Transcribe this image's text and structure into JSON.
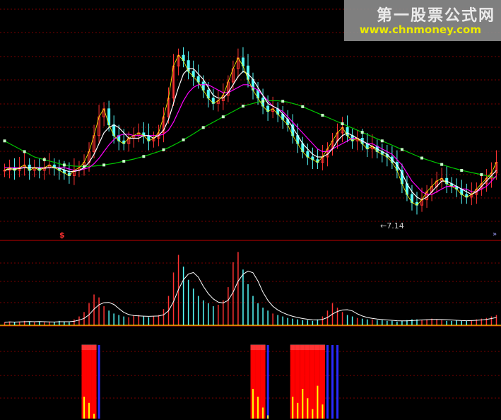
{
  "watermark": {
    "title": "第一股票公式网",
    "url": "www.chnmoney.com"
  },
  "annotations": {
    "low_label": "←7.14",
    "s_marker": "$",
    "right_marker": "»"
  },
  "colors": {
    "background": "#000000",
    "grid": "#7a0000",
    "divider": "#c00000",
    "up": "#ff3232",
    "down": "#54fcfc",
    "ma_white": "#ffffff",
    "ma_yellow": "#ffff00",
    "ma_magenta": "#ff00ff",
    "ma_green": "#00c800",
    "signal_red": "#ff0000",
    "signal_blue": "#2a2aff",
    "signal_yellow": "#ffff00"
  },
  "chart_data": [
    {
      "type": "candlestick",
      "panel": "price",
      "low_value": 7.14,
      "close": [
        8.5,
        8.6,
        8.5,
        8.6,
        8.7,
        8.5,
        8.6,
        8.5,
        8.6,
        8.7,
        8.6,
        8.5,
        8.4,
        8.3,
        8.5,
        8.6,
        8.8,
        9.2,
        9.8,
        10.5,
        10.8,
        10.2,
        9.8,
        9.6,
        9.5,
        9.7,
        9.8,
        9.9,
        9.8,
        9.6,
        9.7,
        9.9,
        10.5,
        11.2,
        12.4,
        12.8,
        12.6,
        12.2,
        12.0,
        11.8,
        11.5,
        11.2,
        11.0,
        11.1,
        11.3,
        11.8,
        12.3,
        12.7,
        12.4,
        11.9,
        11.5,
        11.2,
        10.9,
        10.7,
        10.8,
        10.6,
        10.4,
        10.2,
        9.8,
        9.5,
        9.2,
        9.0,
        8.9,
        8.8,
        9.0,
        9.3,
        9.6,
        9.9,
        10.1,
        9.8,
        9.6,
        9.7,
        9.5,
        9.3,
        9.4,
        9.2,
        9.1,
        9.0,
        8.8,
        8.5,
        8.0,
        7.6,
        7.3,
        7.2,
        7.4,
        7.7,
        7.9,
        8.1,
        8.2,
        8.0,
        7.9,
        7.8,
        7.6,
        7.5,
        7.6,
        7.8,
        8.0,
        8.2,
        8.4,
        8.8
      ],
      "ma_short": [
        8.5,
        8.55,
        8.55,
        8.57,
        8.6,
        8.6,
        8.6,
        8.58,
        8.58,
        8.6,
        8.6,
        8.58,
        8.52,
        8.45,
        8.46,
        8.5,
        8.6,
        8.8,
        9.1,
        9.5,
        9.9,
        10.1,
        10.2,
        10.1,
        9.9,
        9.7,
        9.7,
        9.7,
        9.8,
        9.8,
        9.7,
        9.8,
        10.0,
        10.4,
        11.0,
        11.6,
        12.1,
        12.3,
        12.3,
        12.1,
        11.9,
        11.6,
        11.3,
        11.2,
        11.2,
        11.4,
        11.7,
        12.0,
        12.2,
        12.1,
        11.9,
        11.6,
        11.3,
        11.0,
        10.9,
        10.8,
        10.6,
        10.4,
        10.1,
        9.8,
        9.5,
        9.3,
        9.1,
        9.0,
        9.0,
        9.1,
        9.3,
        9.6,
        9.8,
        9.9,
        9.8,
        9.7,
        9.6,
        9.5,
        9.4,
        9.3,
        9.2,
        9.1,
        8.9,
        8.7,
        8.4,
        8.0,
        7.7,
        7.5,
        7.4,
        7.5,
        7.7,
        7.9,
        8.1,
        8.1,
        8.0,
        7.9,
        7.8,
        7.7,
        7.6,
        7.7,
        7.9,
        8.1,
        8.3,
        8.5
      ],
      "ma_mid": [
        8.6,
        8.6,
        8.6,
        8.6,
        8.6,
        8.6,
        8.6,
        8.6,
        8.6,
        8.6,
        8.6,
        8.6,
        8.6,
        8.55,
        8.5,
        8.5,
        8.55,
        8.6,
        8.75,
        8.95,
        9.2,
        9.45,
        9.65,
        9.8,
        9.85,
        9.85,
        9.8,
        9.8,
        9.8,
        9.8,
        9.8,
        9.8,
        9.85,
        10.0,
        10.3,
        10.7,
        11.1,
        11.4,
        11.6,
        11.7,
        11.7,
        11.7,
        11.6,
        11.5,
        11.4,
        11.4,
        11.5,
        11.6,
        11.7,
        11.7,
        11.6,
        11.5,
        11.3,
        11.1,
        10.9,
        10.8,
        10.7,
        10.5,
        10.3,
        10.1,
        9.9,
        9.7,
        9.5,
        9.3,
        9.2,
        9.2,
        9.3,
        9.4,
        9.5,
        9.6,
        9.7,
        9.7,
        9.6,
        9.5,
        9.5,
        9.4,
        9.3,
        9.2,
        9.1,
        8.9,
        8.7,
        8.4,
        8.1,
        7.9,
        7.7,
        7.6,
        7.6,
        7.7,
        7.8,
        7.9,
        7.9,
        7.9,
        7.8,
        7.8,
        7.7,
        7.7,
        7.8,
        7.9,
        8.1,
        8.3
      ],
      "ma_long": [
        9.6,
        9.5,
        9.4,
        9.3,
        9.2,
        9.1,
        9.0,
        8.95,
        8.9,
        8.85,
        8.8,
        8.75,
        8.7,
        8.68,
        8.66,
        8.65,
        8.64,
        8.65,
        8.66,
        8.68,
        8.7,
        8.73,
        8.76,
        8.8,
        8.84,
        8.88,
        8.92,
        8.97,
        9.02,
        9.08,
        9.14,
        9.2,
        9.27,
        9.35,
        9.44,
        9.54,
        9.64,
        9.75,
        9.86,
        9.98,
        10.1,
        10.2,
        10.3,
        10.4,
        10.5,
        10.6,
        10.7,
        10.8,
        10.9,
        10.95,
        11.0,
        11.05,
        11.08,
        11.1,
        11.1,
        11.1,
        11.08,
        11.05,
        11.0,
        10.95,
        10.88,
        10.8,
        10.72,
        10.64,
        10.56,
        10.48,
        10.4,
        10.32,
        10.24,
        10.16,
        10.08,
        10.0,
        9.92,
        9.84,
        9.76,
        9.68,
        9.6,
        9.52,
        9.44,
        9.36,
        9.28,
        9.2,
        9.12,
        9.04,
        8.96,
        8.9,
        8.84,
        8.78,
        8.72,
        8.66,
        8.6,
        8.55,
        8.5,
        8.46,
        8.42,
        8.38,
        8.34,
        8.3,
        8.26,
        8.22
      ],
      "y_range": [
        6.2,
        14.6
      ]
    },
    {
      "type": "bar",
      "panel": "volume",
      "values": [
        4,
        5,
        4,
        5,
        6,
        5,
        4,
        5,
        4,
        5,
        4,
        6,
        5,
        4,
        8,
        12,
        18,
        30,
        42,
        38,
        26,
        20,
        16,
        14,
        12,
        11,
        13,
        14,
        12,
        11,
        12,
        14,
        22,
        40,
        72,
        96,
        80,
        62,
        50,
        40,
        34,
        30,
        26,
        28,
        34,
        52,
        86,
        100,
        76,
        56,
        40,
        30,
        24,
        20,
        16,
        14,
        12,
        10,
        9,
        8,
        7,
        7,
        6,
        8,
        12,
        20,
        30,
        24,
        18,
        14,
        12,
        10,
        9,
        8,
        8,
        7,
        7,
        6,
        6,
        5,
        6,
        7,
        8,
        8,
        7,
        8,
        9,
        8,
        7,
        6,
        6,
        7,
        6,
        6,
        7,
        8,
        9,
        10,
        12,
        14
      ],
      "y_range": [
        0,
        110
      ]
    },
    {
      "type": "bar",
      "panel": "signal",
      "red": [
        0,
        0,
        0,
        0,
        0,
        0,
        0,
        0,
        0,
        0,
        0,
        0,
        0,
        0,
        0,
        0,
        1,
        1,
        1,
        0,
        0,
        0,
        0,
        0,
        0,
        0,
        0,
        0,
        0,
        0,
        0,
        0,
        0,
        0,
        0,
        0,
        0,
        0,
        0,
        0,
        0,
        0,
        0,
        0,
        0,
        0,
        0,
        0,
        0,
        0,
        1,
        1,
        1,
        0,
        0,
        0,
        0,
        0,
        1,
        1,
        1,
        1,
        1,
        1,
        1,
        0,
        0,
        0,
        0,
        0,
        0,
        0,
        0,
        0,
        0,
        0,
        0,
        0,
        0,
        0,
        0,
        0,
        0,
        0,
        0,
        0,
        0,
        0,
        0,
        0,
        0,
        0,
        0,
        0,
        0,
        0,
        0,
        0,
        0,
        0
      ],
      "blue": [
        0,
        0,
        0,
        0,
        0,
        0,
        0,
        0,
        0,
        0,
        0,
        0,
        0,
        0,
        0,
        0,
        0,
        0,
        0,
        1,
        0,
        0,
        0,
        0,
        0,
        0,
        0,
        0,
        0,
        0,
        0,
        0,
        0,
        0,
        0,
        0,
        0,
        0,
        0,
        0,
        0,
        0,
        0,
        0,
        0,
        0,
        0,
        0,
        0,
        0,
        0,
        0,
        0,
        1,
        0,
        0,
        0,
        0,
        0,
        0,
        0,
        0,
        0,
        0,
        0,
        1,
        1,
        1,
        0,
        0,
        0,
        0,
        0,
        0,
        0,
        0,
        0,
        0,
        0,
        0,
        0,
        0,
        0,
        0,
        0,
        0,
        0,
        0,
        0,
        0,
        0,
        0,
        0,
        0,
        0,
        0,
        0,
        0,
        0,
        0
      ],
      "yellow": [
        0,
        0,
        0,
        0,
        0,
        0,
        0,
        0,
        0,
        0,
        0,
        0,
        0,
        0,
        0,
        0,
        30,
        22,
        8,
        0,
        0,
        0,
        0,
        0,
        0,
        0,
        0,
        0,
        0,
        0,
        0,
        0,
        0,
        0,
        0,
        0,
        0,
        0,
        0,
        0,
        0,
        0,
        0,
        0,
        0,
        0,
        0,
        0,
        0,
        0,
        40,
        30,
        16,
        6,
        0,
        0,
        0,
        0,
        30,
        22,
        40,
        28,
        14,
        44,
        20,
        0,
        0,
        0,
        0,
        0,
        0,
        0,
        0,
        0,
        0,
        0,
        0,
        0,
        0,
        0,
        0,
        0,
        0,
        0,
        0,
        0,
        0,
        0,
        0,
        0,
        0,
        0,
        0,
        0,
        0,
        0,
        0,
        0,
        0,
        0
      ],
      "y_range": [
        0,
        100
      ]
    }
  ]
}
